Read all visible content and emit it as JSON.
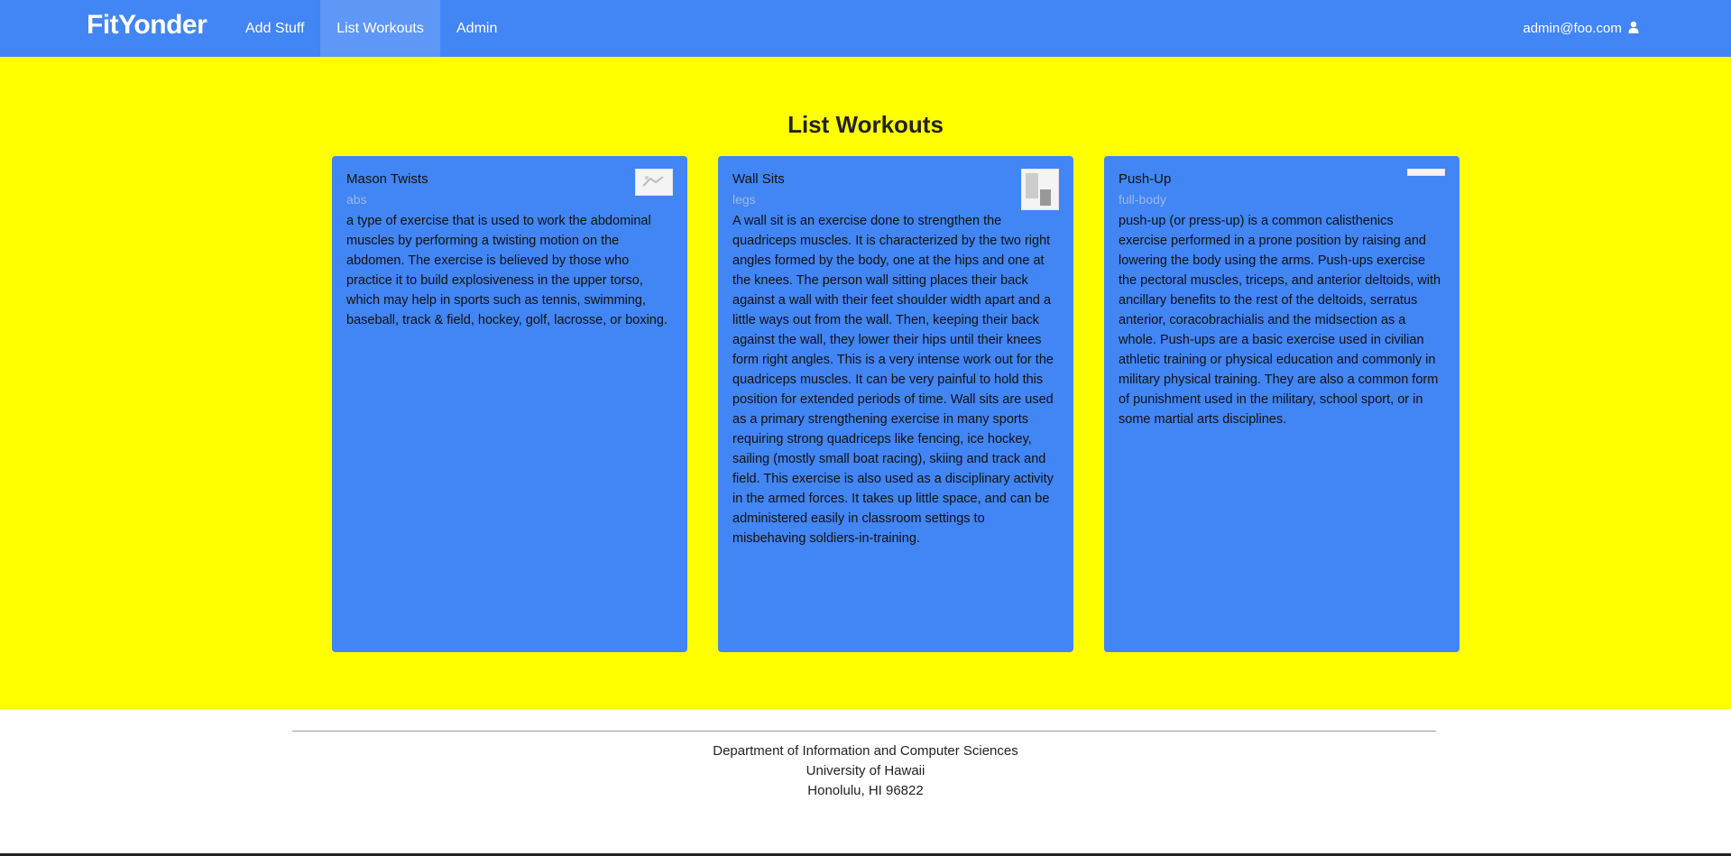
{
  "navbar": {
    "brand": "FitYonder",
    "links": [
      {
        "label": "Add Stuff",
        "active": false
      },
      {
        "label": "List Workouts",
        "active": true
      },
      {
        "label": "Admin",
        "active": false
      }
    ],
    "user": "admin@foo.com",
    "user_icon": "user-icon"
  },
  "page": {
    "title": "List Workouts"
  },
  "cards": [
    {
      "title": "Mason Twists",
      "category": "abs",
      "description": "a type of exercise that is used to work the abdominal muscles by performing a twisting motion on the abdomen. The exercise is believed by those who practice it to build explosiveness in the upper torso, which may help in sports such as tennis, swimming, baseball, track & field, hockey, golf, lacrosse, or boxing."
    },
    {
      "title": "Wall Sits",
      "category": "legs",
      "description": "A wall sit is an exercise done to strengthen the quadriceps muscles. It is characterized by the two right angles formed by the body, one at the hips and one at the knees. The person wall sitting places their back against a wall with their feet shoulder width apart and a little ways out from the wall. Then, keeping their back against the wall, they lower their hips until their knees form right angles. This is a very intense work out for the quadriceps muscles. It can be very painful to hold this position for extended periods of time. Wall sits are used as a primary strengthening exercise in many sports requiring strong quadriceps like fencing, ice hockey, sailing (mostly small boat racing), skiing and track and field. This exercise is also used as a disciplinary activity in the armed forces. It takes up little space, and can be administered easily in classroom settings to misbehaving soldiers-in-training."
    },
    {
      "title": "Push-Up",
      "category": "full-body",
      "description": "push-up (or press-up) is a common calisthenics exercise performed in a prone position by raising and lowering the body using the arms. Push-ups exercise the pectoral muscles, triceps, and anterior deltoids, with ancillary benefits to the rest of the deltoids, serratus anterior, coracobrachialis and the midsection as a whole. Push-ups are a basic exercise used in civilian athletic training or physical education and commonly in military physical training. They are also a common form of punishment used in the military, school sport, or in some martial arts disciplines."
    }
  ],
  "footer": {
    "line1": "Department of Information and Computer Sciences",
    "line2": "University of Hawaii",
    "line3": "Honolulu, HI 96822"
  },
  "colors": {
    "navbar": "#4285f4",
    "background": "#ffff00",
    "card": "#4285f4"
  }
}
